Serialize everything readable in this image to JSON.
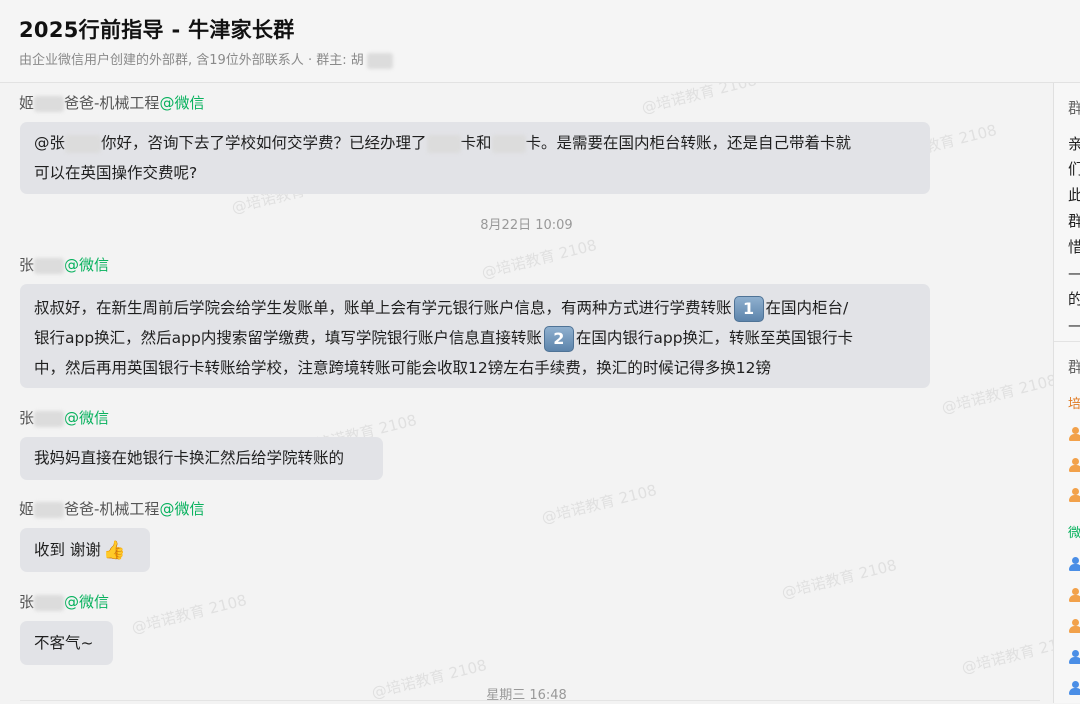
{
  "header": {
    "title": "2025行前指导 - 牛津家长群",
    "subtitle": "由企业微信用户创建的外部群, 含19位外部联系人 · 群主: 胡"
  },
  "watermark": "@培诺教育 2108",
  "messages": [
    {
      "sender_prefix": "姬",
      "sender_suffix": "爸爸-机械工程",
      "source": "@微信",
      "text_parts": [
        "@张",
        "你好，咨询下去了学校如何交学费？已经办理了",
        "卡和",
        "卡。是需要在国内柜台转账，还是自己带着卡就",
        "可以在英国操作交费呢?"
      ]
    },
    {
      "sender_prefix": "张",
      "source": "@微信",
      "text_parts": [
        "叔叔好，在新生周前后学院会给学生发账单，账单上会有学元银行账户信息，有两种方式进行学费转账",
        "在国内柜台/",
        "银行app换汇，然后app内搜索留学缴费，填写学院银行账户信息直接转账",
        "在国内银行app换汇，转账至英国银行卡",
        "中，然后再用英国银行卡转账给学校，注意跨境转账可能会收取12镑左右手续费，换汇的时候记得多换12镑"
      ],
      "badges": [
        "1",
        "2"
      ]
    },
    {
      "sender_prefix": "张",
      "source": "@微信",
      "text": "我妈妈直接在她银行卡换汇然后给学院转账的"
    },
    {
      "sender_prefix": "姬",
      "sender_suffix": "爸爸-机械工程",
      "source": "@微信",
      "text": "收到 谢谢"
    },
    {
      "sender_prefix": "张",
      "source": "@微信",
      "text": "不客气~"
    }
  ],
  "timestamps": [
    "8月22日 10:09",
    "星期三 16:48"
  ],
  "side_panel": {
    "chars": [
      "群",
      "亲",
      "们",
      "此",
      "群",
      "惜",
      "—",
      "的",
      "—",
      "群",
      "培",
      "微"
    ]
  }
}
